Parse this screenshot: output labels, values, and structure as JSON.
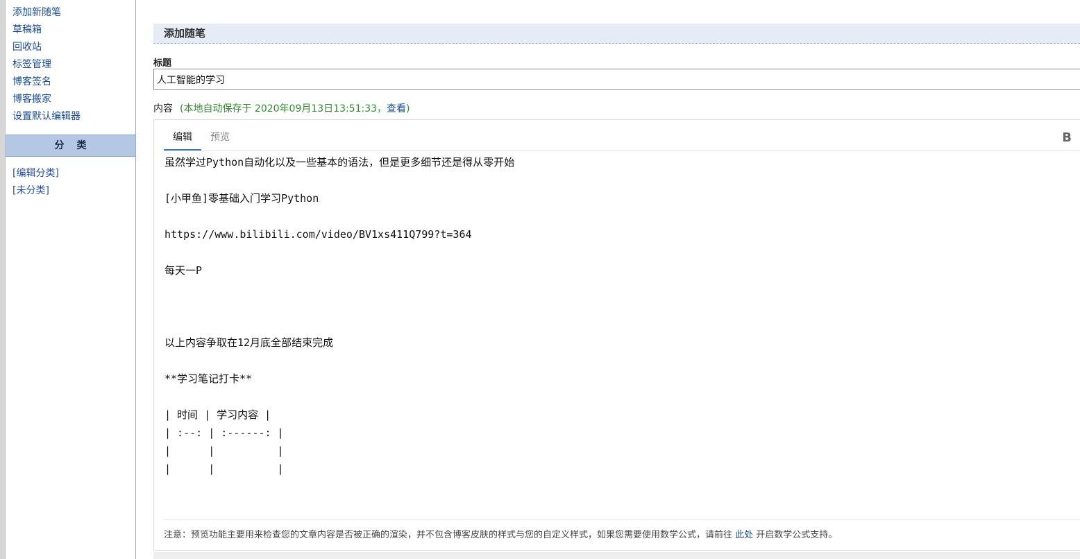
{
  "sidebar": {
    "nav": [
      {
        "label": "添加新随笔"
      },
      {
        "label": "草稿箱"
      },
      {
        "label": "回收站"
      },
      {
        "label": "标签管理"
      },
      {
        "label": "博客签名"
      },
      {
        "label": "博客搬家"
      },
      {
        "label": "设置默认编辑器"
      }
    ],
    "category_header": "分类",
    "categories": [
      {
        "label": "[编辑分类]"
      },
      {
        "label": "[未分类]"
      }
    ]
  },
  "main": {
    "section_title": "添加随笔",
    "title_label": "标题",
    "title_value": "人工智能的学习",
    "content_label": "内容",
    "autosave_prefix": "(本地自动保存于 2020年09月13日13:51:33，",
    "autosave_link": "查看",
    "autosave_suffix": ")",
    "editor": {
      "tabs": [
        {
          "label": "编辑",
          "active": true
        },
        {
          "label": "预览",
          "active": false
        }
      ],
      "bold_button": "B",
      "text": "虽然学过Python自动化以及一些基本的语法，但是更多细节还是得从零开始\n\n[小甲鱼]零基础入门学习Python\n\nhttps://www.bilibili.com/video/BV1xs411Q799?t=364\n\n每天一P\n\n\n\n以上内容争取在12月底全部结束完成\n\n**学习笔记打卡**\n\n| 时间 | 学习内容 |\n| :--: | :------: |\n|      |          |\n|      |          |"
    },
    "note_text": "注意：预览功能主要用来检查您的文章内容是否被正确的渲染，并不包含博客皮肤的样式与您的自定义样式，如果您需要使用数学公式，请前往 ",
    "note_link": "此处",
    "note_suffix": " 开启数学公式支持。"
  },
  "colors": {
    "link": "#1a4b8c",
    "autosave": "#2e8b2e",
    "category_header_bg": "#b4c8e4",
    "section_title_bg": "#e6ecf5",
    "tab_active_underline": "#3e75c0"
  }
}
